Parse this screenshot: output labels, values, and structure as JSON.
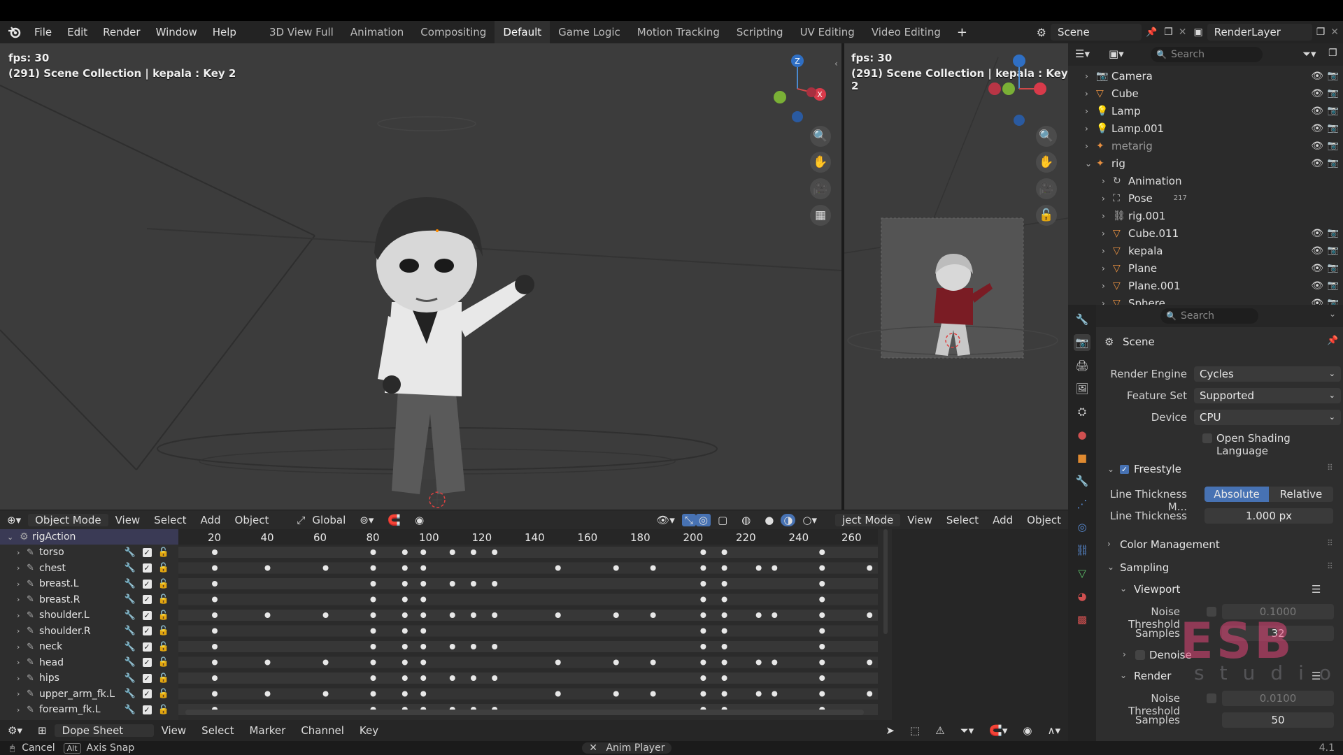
{
  "menu": {
    "items": [
      "File",
      "Edit",
      "Render",
      "Window",
      "Help"
    ],
    "workspaces": [
      "3D View Full",
      "Animation",
      "Compositing",
      "Default",
      "Game Logic",
      "Motion Tracking",
      "Scripting",
      "UV Editing",
      "Video Editing"
    ],
    "active_workspace": "Default",
    "add_label": "+",
    "scene_name": "Scene",
    "render_layer": "RenderLayer"
  },
  "viewport_left": {
    "fps": "fps: 30",
    "info": "(291) Scene Collection | kepala : Key 2"
  },
  "viewport_right": {
    "fps": "fps: 30",
    "info": "(291) Scene Collection | kepala : Key 2"
  },
  "gizmo": {
    "z": "Z",
    "x": "X"
  },
  "viewport_header": {
    "mode": "Object Mode",
    "items": [
      "View",
      "Select",
      "Add",
      "Object"
    ],
    "transform": "Global",
    "right_mode": "ject Mode",
    "right_items": [
      "View",
      "Select",
      "Add",
      "Object"
    ]
  },
  "dope_sheet": {
    "action": "rigAction",
    "frames": [
      "20",
      "40",
      "60",
      "80",
      "100",
      "120",
      "140",
      "160",
      "180",
      "200",
      "220",
      "240",
      "260"
    ],
    "channels": [
      "torso",
      "chest",
      "breast.L",
      "breast.R",
      "shoulder.L",
      "shoulder.R",
      "neck",
      "head",
      "hips",
      "upper_arm_fk.L",
      "forearm_fk.L"
    ]
  },
  "dope_header": {
    "editor": "Dope Sheet",
    "items": [
      "View",
      "Select",
      "Marker",
      "Channel",
      "Key"
    ]
  },
  "status": {
    "cancel": "Cancel",
    "alt": "Alt",
    "axis_snap": "Axis Snap",
    "anim_player": "Anim Player",
    "version": "4.1"
  },
  "outliner": {
    "search_placeholder": "Search",
    "items": [
      {
        "name": "Camera",
        "indent": 0
      },
      {
        "name": "Cube",
        "indent": 0
      },
      {
        "name": "Lamp",
        "indent": 0
      },
      {
        "name": "Lamp.001",
        "indent": 0
      },
      {
        "name": "metarig",
        "indent": 0
      },
      {
        "name": "rig",
        "indent": 0
      },
      {
        "name": "Animation",
        "indent": 1
      },
      {
        "name": "Pose",
        "indent": 1
      },
      {
        "name": "rig.001",
        "indent": 1
      },
      {
        "name": "Cube.011",
        "indent": 1
      },
      {
        "name": "kepala",
        "indent": 1
      },
      {
        "name": "Plane",
        "indent": 1
      },
      {
        "name": "Plane.001",
        "indent": 1
      },
      {
        "name": "Sphere",
        "indent": 1
      }
    ],
    "pose_badge": "217"
  },
  "properties": {
    "search_placeholder": "Search",
    "context": "Scene",
    "render_engine_label": "Render Engine",
    "render_engine": "Cycles",
    "feature_set_label": "Feature Set",
    "feature_set": "Supported",
    "device_label": "Device",
    "device": "CPU",
    "osl": "Open Shading Language",
    "freestyle": "Freestyle",
    "line_thickness_mode_label": "Line Thickness M...",
    "absolute": "Absolute",
    "relative": "Relative",
    "line_thickness_label": "Line Thickness",
    "line_thickness": "1.000 px",
    "color_management": "Color Management",
    "sampling": "Sampling",
    "viewport": "Viewport",
    "noise_threshold_label": "Noise Threshold",
    "viewport_noise": "0.1000",
    "samples_label": "Samples",
    "viewport_samples": "32",
    "denoise": "Denoise",
    "render": "Render",
    "render_noise": "0.0100",
    "render_samples": "50"
  },
  "watermark": {
    "line1": "ESB",
    "line2": "studio"
  },
  "colors": {
    "accent": "#4772b3",
    "active_ws": "#303030",
    "watermark": "#e24578"
  }
}
